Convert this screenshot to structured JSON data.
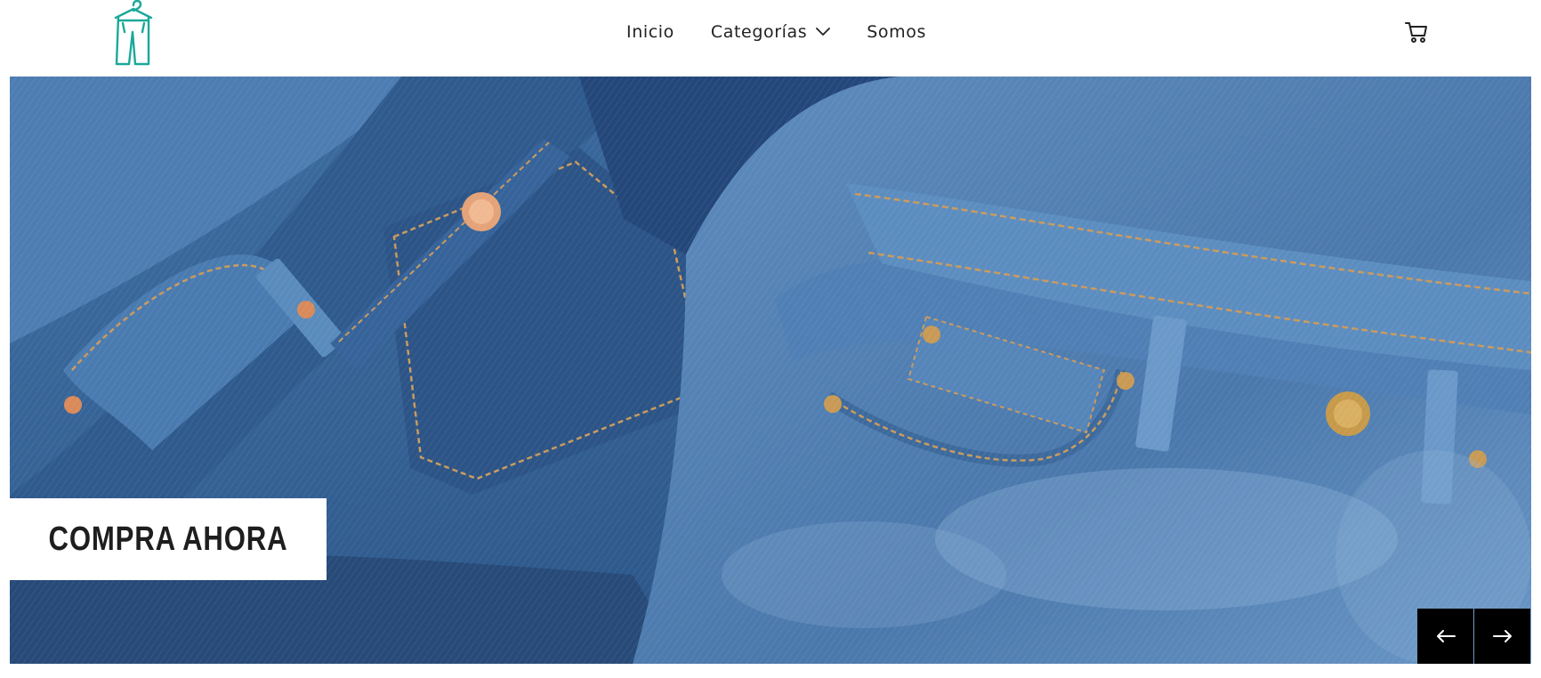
{
  "header": {
    "logo_icon": "hanging-pants-icon",
    "brand_color": "#1aa99a",
    "nav": {
      "items": [
        {
          "label": "Inicio"
        },
        {
          "label": "Categorías",
          "icon": "chevron-down-icon"
        },
        {
          "label": "Somos"
        }
      ]
    },
    "cart_icon": "shopping-cart-icon"
  },
  "hero": {
    "image": "denim-jeans-background",
    "cta_label": "COMPRA AHORA",
    "prev_icon": "arrow-left-icon",
    "next_icon": "arrow-right-icon",
    "arrow_bg": "#000000"
  }
}
